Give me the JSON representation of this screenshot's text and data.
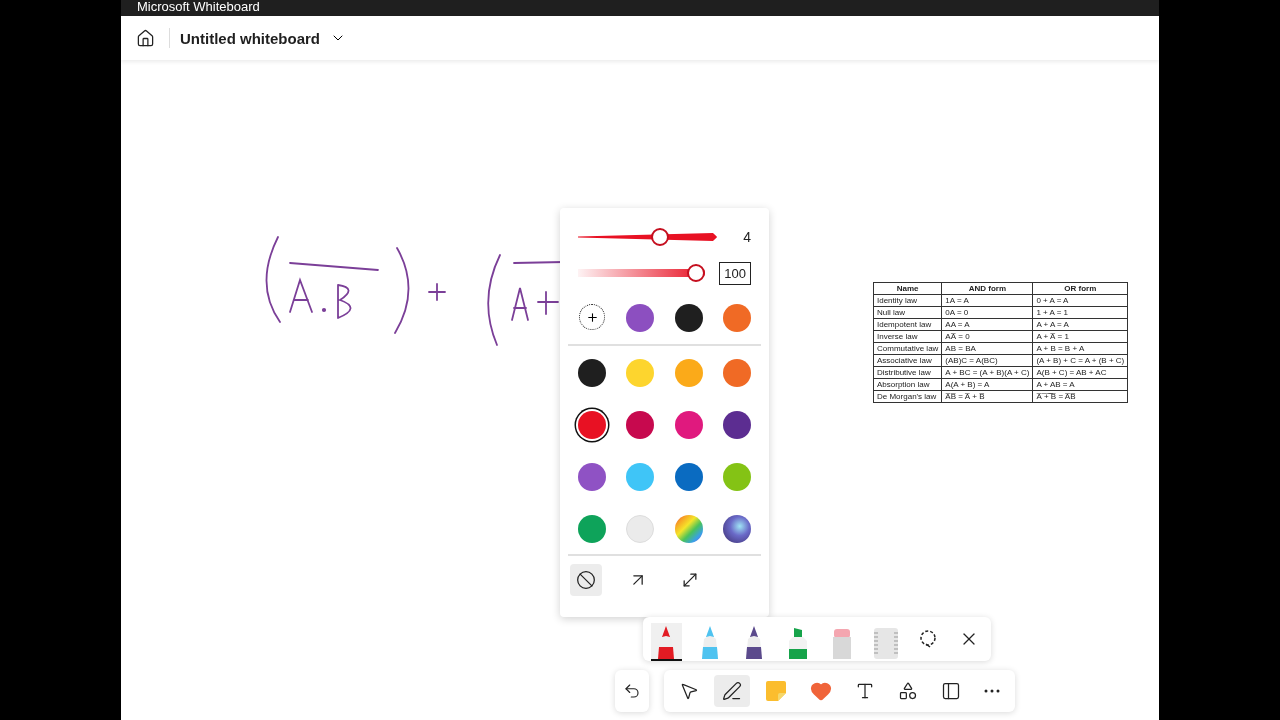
{
  "window": {
    "title": "Microsoft Whiteboard"
  },
  "header": {
    "board_title": "Untitled whiteboard"
  },
  "pen_panel": {
    "thickness": {
      "level": 0.6,
      "reading": "4"
    },
    "opacity": {
      "level": 1,
      "value": "100"
    },
    "recent_colors": [
      {
        "kind": "add"
      },
      {
        "kind": "solid",
        "color": "#8c4fc0",
        "selected": false
      },
      {
        "kind": "solid",
        "color": "#1f1f1f",
        "selected": false
      },
      {
        "kind": "solid",
        "color": "#f06a25",
        "selected": false
      }
    ],
    "palette": [
      {
        "kind": "solid",
        "color": "#1f1f1f",
        "selected": false
      },
      {
        "kind": "solid",
        "color": "#fdd52e",
        "selected": false
      },
      {
        "kind": "solid",
        "color": "#fbaa19",
        "selected": false
      },
      {
        "kind": "solid",
        "color": "#f06a25",
        "selected": false
      },
      {
        "kind": "solid",
        "color": "#e81123",
        "selected": true
      },
      {
        "kind": "solid",
        "color": "#c7094e",
        "selected": false
      },
      {
        "kind": "solid",
        "color": "#e0197e",
        "selected": false
      },
      {
        "kind": "solid",
        "color": "#5c2d91",
        "selected": false
      },
      {
        "kind": "solid",
        "color": "#8f52c4",
        "selected": false
      },
      {
        "kind": "solid",
        "color": "#3fc5f7",
        "selected": false
      },
      {
        "kind": "solid",
        "color": "#0a6bc1",
        "selected": false
      },
      {
        "kind": "solid",
        "color": "#84c315",
        "selected": false
      },
      {
        "kind": "solid",
        "color": "#0ea35a",
        "selected": false
      },
      {
        "kind": "solid",
        "color": "#ebebeb",
        "selected": false
      },
      {
        "kind": "rainbow",
        "selected": false
      },
      {
        "kind": "galaxy",
        "selected": false
      }
    ],
    "line_ends": [
      {
        "kind": "none",
        "selected": true
      },
      {
        "kind": "arrow",
        "selected": false
      },
      {
        "kind": "double-arrow",
        "selected": false
      }
    ]
  },
  "pen_tray": [
    {
      "kind": "pen",
      "color": "#e21b23",
      "selected": true
    },
    {
      "kind": "pen",
      "color": "#4fc3f0",
      "selected": false
    },
    {
      "kind": "pen",
      "color": "#5b4a8c",
      "selected": false
    },
    {
      "kind": "highlighter",
      "color": "#16a34a",
      "selected": false
    },
    {
      "kind": "eraser",
      "selected": false
    },
    {
      "kind": "ruler",
      "selected": false
    }
  ],
  "toolbar": [
    {
      "kind": "select",
      "selected": false
    },
    {
      "kind": "ink",
      "selected": true
    },
    {
      "kind": "note",
      "selected": false
    },
    {
      "kind": "reaction",
      "selected": false
    },
    {
      "kind": "text",
      "selected": false
    },
    {
      "kind": "shapes",
      "selected": false
    },
    {
      "kind": "templates",
      "selected": false
    },
    {
      "kind": "more",
      "selected": false
    }
  ],
  "table": {
    "columns": [
      "Name",
      "AND form",
      "OR form"
    ],
    "rows": [
      [
        "Identity law",
        "1A = A",
        "0 + A = A"
      ],
      [
        "Null law",
        "0A = 0",
        "1 + A = 1"
      ],
      [
        "Idempotent law",
        "AA = A",
        "A + A = A"
      ],
      [
        "Inverse law",
        "AA̅ = 0",
        "A + A̅ = 1"
      ],
      [
        "Commutative law",
        "AB = BA",
        "A + B = B + A"
      ],
      [
        "Associative law",
        "(AB)C = A(BC)",
        "(A + B) + C = A + (B + C)"
      ],
      [
        "Distributive law",
        "A + BC = (A + B)(A + C)",
        "A(B + C) = AB + AC"
      ],
      [
        "Absorption law",
        "A(A + B) = A",
        "A + AB = A"
      ],
      [
        "De Morgan's law",
        "A̅B̅ = A̅ + B̅",
        "A̅ ̅+̅ ̅B̅ = A̅B̅"
      ]
    ]
  }
}
